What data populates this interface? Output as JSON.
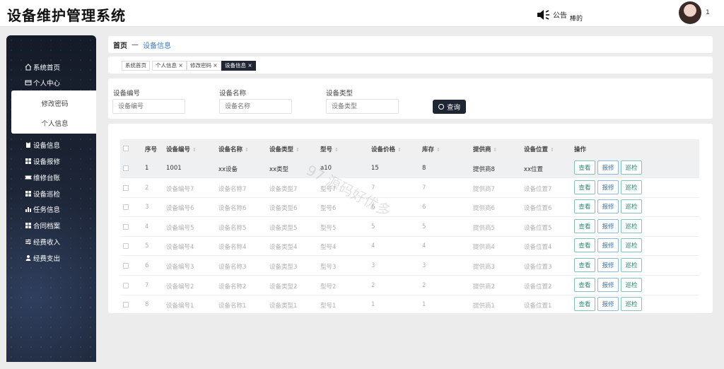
{
  "app": {
    "title": "设备维护管理系统"
  },
  "header": {
    "notice_label": "公告",
    "notice_text": "棒的",
    "user_badge": "1"
  },
  "sidebar": {
    "items": [
      {
        "label": "系统首页",
        "icon": "home-icon"
      },
      {
        "label": "个人中心",
        "icon": "card-icon"
      },
      {
        "label": "设备信息",
        "icon": "clipboard-icon"
      },
      {
        "label": "设备报修",
        "icon": "grid-icon"
      },
      {
        "label": "维修台账",
        "icon": "ticket-icon"
      },
      {
        "label": "设备巡检",
        "icon": "grid-icon"
      },
      {
        "label": "任务信息",
        "icon": "bar-chart-icon"
      },
      {
        "label": "合同档案",
        "icon": "grid-icon"
      },
      {
        "label": "经费收入",
        "icon": "sliders-icon"
      },
      {
        "label": "经费支出",
        "icon": "user-icon"
      }
    ],
    "submenu": [
      "修改密码",
      "个人信息"
    ]
  },
  "breadcrumb": {
    "home": "首页",
    "sep": "—",
    "current": "设备信息"
  },
  "tags": [
    {
      "label": "系统首页"
    },
    {
      "label": "个人信息 ×"
    },
    {
      "label": "修改密码 ×"
    },
    {
      "label": "设备信息 ×",
      "active": true
    }
  ],
  "search": {
    "fields": [
      {
        "label": "设备编号",
        "placeholder": "设备编号"
      },
      {
        "label": "设备名称",
        "placeholder": "设备名称"
      },
      {
        "label": "设备类型",
        "placeholder": "设备类型"
      }
    ],
    "button": "查询"
  },
  "table": {
    "columns": [
      "序号",
      "设备编号",
      "设备名称",
      "设备类型",
      "型号",
      "设备价格",
      "库存",
      "提供商",
      "设备位置",
      "操作"
    ],
    "rows": [
      [
        "1",
        "1001",
        "xx设备",
        "xx类型",
        "a10",
        "15",
        "8",
        "提供商8",
        "xx位置"
      ],
      [
        "2",
        "设备编号7",
        "设备名称7",
        "设备类型7",
        "型号7",
        "7",
        "7",
        "提供商7",
        "设备位置7"
      ],
      [
        "3",
        "设备编号6",
        "设备名称6",
        "设备类型6",
        "型号6",
        "6",
        "6",
        "提供商6",
        "设备位置6"
      ],
      [
        "4",
        "设备编号5",
        "设备名称5",
        "设备类型5",
        "型号5",
        "5",
        "5",
        "提供商5",
        "设备位置5"
      ],
      [
        "5",
        "设备编号4",
        "设备名称4",
        "设备类型4",
        "型号4",
        "4",
        "4",
        "提供商4",
        "设备位置4"
      ],
      [
        "6",
        "设备编号3",
        "设备名称3",
        "设备类型3",
        "型号3",
        "3",
        "3",
        "提供商3",
        "设备位置3"
      ],
      [
        "7",
        "设备编号2",
        "设备名称2",
        "设备类型2",
        "型号2",
        "2",
        "2",
        "提供商2",
        "设备位置2"
      ],
      [
        "8",
        "设备编号1",
        "设备名称1",
        "设备类型1",
        "型号1",
        "1",
        "1",
        "提供商1",
        "设备位置1"
      ]
    ],
    "actions": [
      "查看",
      "报修",
      "巡检"
    ]
  },
  "watermark": "97 源码好优多"
}
